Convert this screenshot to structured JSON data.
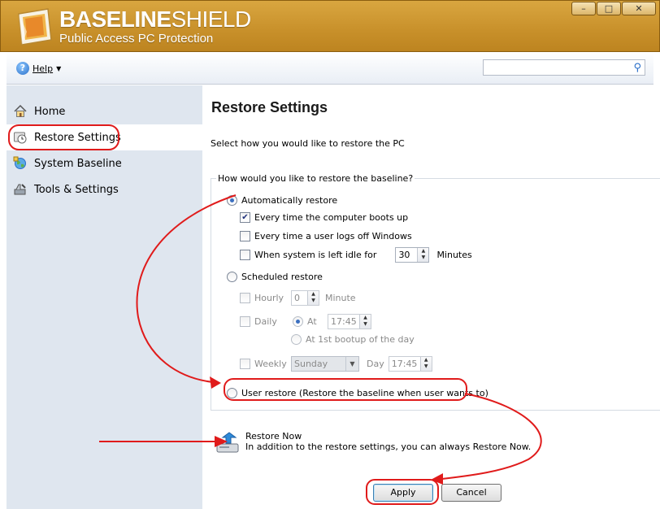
{
  "app": {
    "brand_main": "BASELINE",
    "brand_thin": "SHIELD",
    "tagline": "Public Access PC Protection",
    "window_buttons": [
      "–",
      "□",
      "✕"
    ]
  },
  "toolbar": {
    "help_label": "Help",
    "search_placeholder": ""
  },
  "sidebar": {
    "items": [
      {
        "label": "Home",
        "icon": "home-icon"
      },
      {
        "label": "Restore Settings",
        "icon": "restore-clock-icon"
      },
      {
        "label": "System Baseline",
        "icon": "globe-icon"
      },
      {
        "label": "Tools & Settings",
        "icon": "tools-icon"
      }
    ],
    "selected": "Restore Settings"
  },
  "main": {
    "title": "Restore Settings",
    "subtitle": "Select how you would like to restore the PC",
    "group_legend": "How would you like to restore the baseline?",
    "auto_restore": {
      "label": "Automatically restore",
      "selected": true,
      "every_boot": {
        "label": "Every time the computer boots up",
        "checked": true
      },
      "every_logoff": {
        "label": "Every time a user logs off Windows",
        "checked": false
      },
      "idle": {
        "label": "When system is left idle for",
        "checked": false,
        "value": "30",
        "unit": "Minutes"
      }
    },
    "scheduled_restore": {
      "label": "Scheduled restore",
      "selected": false,
      "hourly": {
        "label": "Hourly",
        "value": "0",
        "unit": "Minute"
      },
      "daily": {
        "label": "Daily",
        "at_label": "At",
        "at_value": "17:45",
        "first_bootup_label": "At 1st bootup of the day"
      },
      "weekly": {
        "label": "Weekly",
        "day_value": "Sunday",
        "day_label": "Day",
        "time_value": "17:45"
      }
    },
    "user_restore": {
      "label": "User restore (Restore the baseline when user wants to)",
      "selected": false
    },
    "restore_now": {
      "title": "Restore Now",
      "description": "In addition to the restore settings, you can always Restore Now."
    },
    "buttons": {
      "apply": "Apply",
      "cancel": "Cancel"
    }
  },
  "colors": {
    "title_bar": "#c8902a",
    "sidebar_bg": "#dfe6ef",
    "annotation_red": "#e01b1b"
  }
}
